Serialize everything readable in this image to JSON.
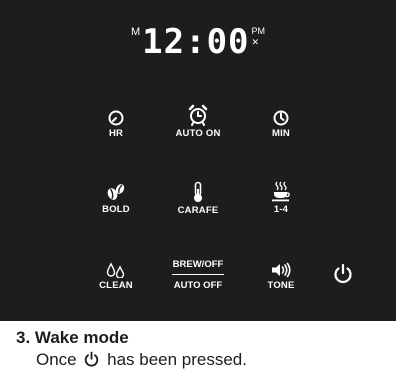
{
  "display": {
    "mode_letter": "M",
    "time": "12:00",
    "pm_label": "PM",
    "alarm_mark": "✕"
  },
  "buttons": {
    "hr": {
      "label": "HR",
      "icon": "clock-hour-icon"
    },
    "auto_on": {
      "label": "AUTO ON",
      "icon": "alarm-clock-icon"
    },
    "min": {
      "label": "MIN",
      "icon": "clock-minute-icon"
    },
    "bold": {
      "label": "BOLD",
      "icon": "coffee-beans-icon"
    },
    "carafe": {
      "label": "CARAFE",
      "icon": "thermometer-icon"
    },
    "one_to_four": {
      "label": "1-4",
      "icon": "coffee-cup-icon"
    },
    "clean": {
      "label": "CLEAN",
      "icon": "water-drops-icon"
    },
    "brew_off": {
      "top_label": "BREW/OFF",
      "bottom_label": "AUTO OFF"
    },
    "tone": {
      "label": "TONE",
      "icon": "speaker-icon"
    },
    "power": {
      "icon": "power-icon"
    }
  },
  "caption": {
    "heading": "3. Wake mode",
    "text_before": "Once",
    "text_after": "has been pressed."
  },
  "colors": {
    "panel": "#1d1d1d",
    "text_light": "#ffffff",
    "text_dark": "#1d1d1d"
  }
}
